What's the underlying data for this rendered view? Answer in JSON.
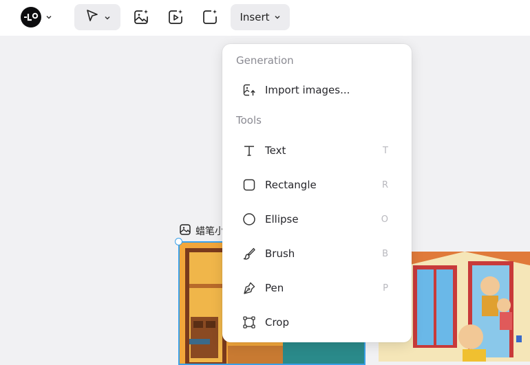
{
  "toolbar": {
    "insert_label": "Insert"
  },
  "menu": {
    "section_generation": "Generation",
    "import_label": "Import images...",
    "section_tools": "Tools",
    "items": [
      {
        "label": "Text",
        "shortcut": "T",
        "icon": "text-icon"
      },
      {
        "label": "Rectangle",
        "shortcut": "R",
        "icon": "rectangle-icon"
      },
      {
        "label": "Ellipse",
        "shortcut": "O",
        "icon": "ellipse-icon"
      },
      {
        "label": "Brush",
        "shortcut": "B",
        "icon": "brush-icon"
      },
      {
        "label": "Pen",
        "shortcut": "P",
        "icon": "pen-icon"
      },
      {
        "label": "Crop",
        "shortcut": "",
        "icon": "crop-icon"
      }
    ]
  },
  "canvas": {
    "artboard_label": "蜡笔小"
  },
  "colors": {
    "selection": "#3aa0e8",
    "menu_bg": "#ffffff",
    "canvas_bg": "#f1f1f3"
  }
}
